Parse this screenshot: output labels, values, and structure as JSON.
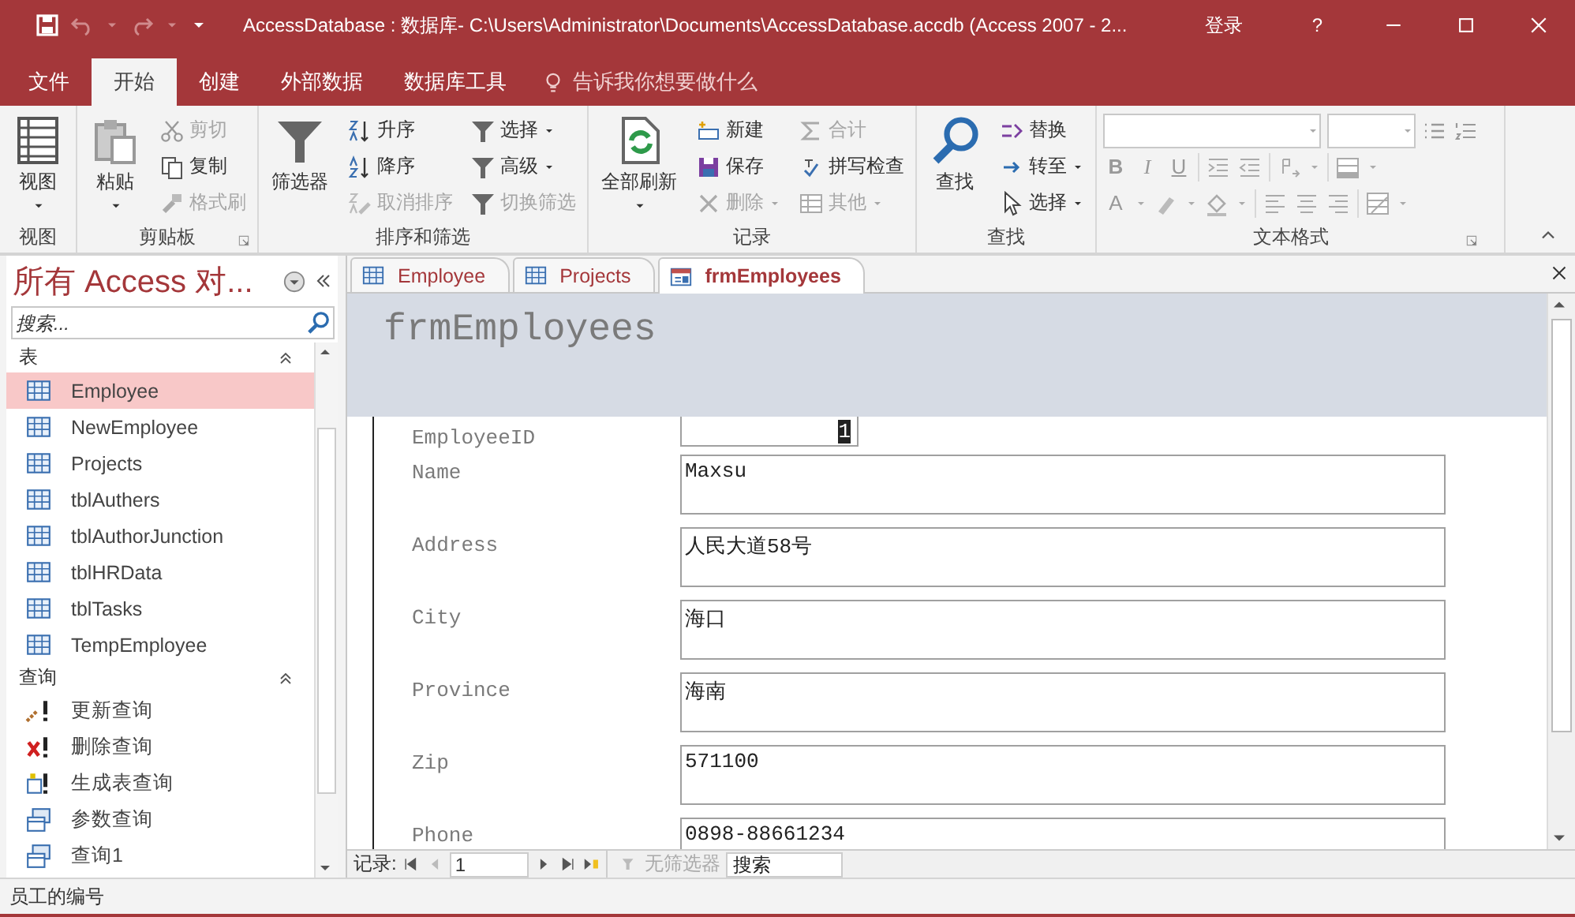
{
  "window": {
    "title": "AccessDatabase : 数据库- C:\\Users\\Administrator\\Documents\\AccessDatabase.accdb (Access 2007 - 2...",
    "sign_in": "登录",
    "help": "?"
  },
  "menu_tabs": [
    {
      "label": "文件",
      "selected": false
    },
    {
      "label": "开始",
      "selected": true
    },
    {
      "label": "创建",
      "selected": false
    },
    {
      "label": "外部数据",
      "selected": false
    },
    {
      "label": "数据库工具",
      "selected": false
    }
  ],
  "tell_me": "告诉我你想要做什么",
  "ribbon": [
    {
      "label": "视图",
      "kind": "buttons",
      "launcher": false,
      "items": [
        {
          "kind": "large",
          "label": "视图",
          "dropdown": true,
          "disabled": false
        }
      ]
    },
    {
      "label": "剪贴板",
      "kind": "buttons",
      "launcher": true,
      "items": [
        {
          "kind": "large",
          "label": "粘贴",
          "dropdown": true,
          "disabled": false
        },
        {
          "kind": "small",
          "label": "剪切",
          "dropdown": false,
          "disabled": true
        },
        {
          "kind": "small",
          "label": "复制",
          "dropdown": false,
          "disabled": false
        },
        {
          "kind": "small",
          "label": "格式刷",
          "dropdown": false,
          "disabled": true
        }
      ]
    },
    {
      "label": "排序和筛选",
      "kind": "buttons",
      "launcher": false,
      "items": [
        {
          "kind": "large",
          "label": "筛选器",
          "dropdown": false,
          "disabled": false
        },
        {
          "kind": "small",
          "label": "升序",
          "dropdown": false,
          "disabled": false
        },
        {
          "kind": "small",
          "label": "降序",
          "dropdown": false,
          "disabled": false
        },
        {
          "kind": "small",
          "label": "取消排序",
          "dropdown": false,
          "disabled": true
        },
        {
          "kind": "small",
          "label": "选择",
          "dropdown": true,
          "disabled": false
        },
        {
          "kind": "small",
          "label": "高级",
          "dropdown": true,
          "disabled": false
        },
        {
          "kind": "small",
          "label": "切换筛选",
          "dropdown": false,
          "disabled": true
        }
      ]
    },
    {
      "label": "记录",
      "kind": "buttons",
      "launcher": false,
      "items": [
        {
          "kind": "large",
          "label": "全部刷新",
          "dropdown": true,
          "disabled": false
        },
        {
          "kind": "small",
          "label": "新建",
          "dropdown": false,
          "disabled": false
        },
        {
          "kind": "small",
          "label": "保存",
          "dropdown": false,
          "disabled": false
        },
        {
          "kind": "small",
          "label": "删除",
          "dropdown": true,
          "disabled": true
        },
        {
          "kind": "small",
          "label": "合计",
          "dropdown": false,
          "disabled": true
        },
        {
          "kind": "small",
          "label": "拼写检查",
          "dropdown": false,
          "disabled": false
        },
        {
          "kind": "small",
          "label": "其他",
          "dropdown": true,
          "disabled": true
        }
      ]
    },
    {
      "label": "查找",
      "kind": "buttons",
      "launcher": false,
      "items": [
        {
          "kind": "large",
          "label": "查找",
          "dropdown": false,
          "disabled": false
        },
        {
          "kind": "small",
          "label": "替换",
          "dropdown": false,
          "disabled": false
        },
        {
          "kind": "small",
          "label": "转至",
          "dropdown": true,
          "disabled": false
        },
        {
          "kind": "small",
          "label": "选择",
          "dropdown": true,
          "disabled": false
        }
      ]
    },
    {
      "label": "文本格式",
      "kind": "format",
      "launcher": true,
      "text_buttons": [
        "B",
        "I",
        "U",
        "A"
      ]
    }
  ],
  "navigation": {
    "title": "所有 Access 对...",
    "search_placeholder": "搜索...",
    "groups": [
      {
        "title": "表",
        "expanded": true,
        "items": [
          {
            "label": "Employee",
            "selected": true
          },
          {
            "label": "NewEmployee",
            "selected": false
          },
          {
            "label": "Projects",
            "selected": false
          },
          {
            "label": "tblAuthers",
            "selected": false
          },
          {
            "label": "tblAuthorJunction",
            "selected": false
          },
          {
            "label": "tblHRData",
            "selected": false
          },
          {
            "label": "tblTasks",
            "selected": false
          },
          {
            "label": "TempEmployee",
            "selected": false
          }
        ]
      },
      {
        "title": "查询",
        "expanded": true,
        "items": [
          {
            "label": "更新查询",
            "selected": false
          },
          {
            "label": "删除查询",
            "selected": false
          },
          {
            "label": "生成表查询",
            "selected": false
          },
          {
            "label": "参数查询",
            "selected": false
          },
          {
            "label": "查询1",
            "selected": false
          }
        ]
      }
    ]
  },
  "document_tabs": [
    {
      "label": "Employee",
      "selected": false
    },
    {
      "label": "Projects",
      "selected": false
    },
    {
      "label": "frmEmployees",
      "selected": true
    }
  ],
  "form": {
    "title": "frmEmployees",
    "fields": [
      {
        "label": "EmployeeID",
        "value": "1",
        "kind": "number"
      },
      {
        "label": "Name",
        "value": "Maxsu",
        "kind": "text"
      },
      {
        "label": "Address",
        "value": "人民大道58号",
        "kind": "text"
      },
      {
        "label": "City",
        "value": "海口",
        "kind": "text"
      },
      {
        "label": "Province",
        "value": "海南",
        "kind": "text"
      },
      {
        "label": "Zip",
        "value": "571100",
        "kind": "text"
      },
      {
        "label": "Phone",
        "value": "0898-88661234",
        "kind": "text"
      }
    ]
  },
  "record_navigator": {
    "label": "记录:",
    "current": "1",
    "filter": "无筛选器",
    "search_placeholder": "搜索"
  },
  "status_bar": "员工的编号"
}
